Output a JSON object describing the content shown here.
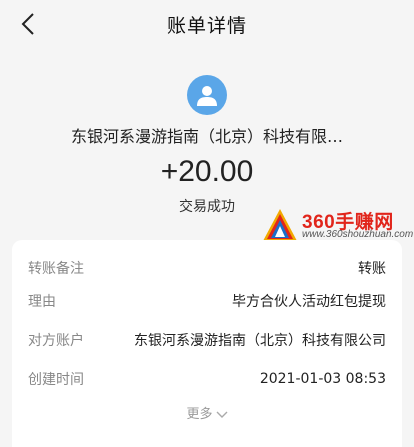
{
  "header": {
    "title": "账单详情",
    "back_icon": "chevron-left-icon"
  },
  "summary": {
    "avatar_icon": "user-avatar-icon",
    "avatar_color": "#5aa6e8",
    "payee": "东银河系漫游指南（北京）科技有限…",
    "amount": "+20.00",
    "status": "交易成功"
  },
  "watermark": {
    "brand": "360手赚网",
    "url": "www.360shouzhuan.com"
  },
  "details": {
    "rows": [
      {
        "label": "转账备注",
        "value": "转账"
      },
      {
        "label": "理由",
        "value": "毕方合伙人活动红包提现"
      },
      {
        "label": "对方账户",
        "value": "东银河系漫游指南（北京）科技有限公司"
      },
      {
        "label": "创建时间",
        "value": "2021-01-03 08:53"
      }
    ],
    "more_label": "更多"
  }
}
